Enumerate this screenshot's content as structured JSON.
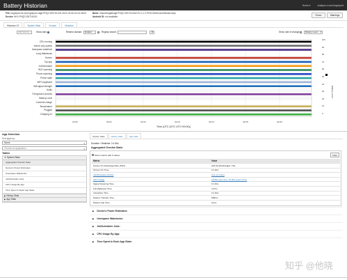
{
  "app": {
    "title": "Battery Historian"
  },
  "nav": {
    "links": [
      "Home ▾",
      "Analyze a new bugreport"
    ]
  },
  "info": {
    "file_label": "File:",
    "file_value": "bugreport-hk.zip bugreport-nagit-PHQ2.190716.001-2021-04-06-22-04-38.txt",
    "device_label": "Device:",
    "device_value": "MI 4 PHQ2.190716.001",
    "build_label": "Build:",
    "build_value": "Xiaomi/nagit/nagit PHQ2.190716.001/V11.2.1.0.PCKCNXM:user/release-keys",
    "android_label": "Android ID:",
    "android_value": "not available",
    "buttons": [
      "Errors",
      "Warnings"
    ]
  },
  "tabs": [
    "Historian V2",
    "System Stats",
    "Custom",
    "Historian"
  ],
  "toolbar": {
    "add_metrics": "Add Metrics",
    "show_bars": "Show bars",
    "restrict_domain": "Restrict domain:",
    "restrict_value": "Default",
    "regexp_search": "Regexp search",
    "show_rate": "Show rate of change",
    "battery_level": "Battery Level"
  },
  "timeline": {
    "rows": [
      {
        "label": "CPU running",
        "color": "#000000"
      },
      {
        "label": "Kernel only uptime",
        "color": "#6b6b6b"
      },
      {
        "label": "Userspace wakelock",
        "color": "#4b2c86"
      },
      {
        "label": "Long Wakelocks",
        "color": "#ffffff"
      },
      {
        "label": "Screen",
        "color": "#c0392b"
      },
      {
        "label": "Top app",
        "color": "#1a5fb4"
      },
      {
        "label": "JobScheduler",
        "color": "#f39c12"
      },
      {
        "label": "BLE scanning",
        "color": "#2e8b57"
      },
      {
        "label": "Phone scanning",
        "color": "#2a46c8"
      },
      {
        "label": "Phone state",
        "color": "#26a3a3"
      },
      {
        "label": "WiFi supplicant",
        "color": "#9fb7d8"
      },
      {
        "label": "Wifi signal strength",
        "color": "#1f6fb8"
      },
      {
        "label": "Audio",
        "color": "#ffffff"
      },
      {
        "label": "Foreground process",
        "color": "#7f3f98"
      },
      {
        "label": "Battery Level",
        "color": "#ffffff"
      },
      {
        "label": "Coulomb charge",
        "color": "#ffffff"
      },
      {
        "label": "Temperature",
        "color": "#c9b25a"
      },
      {
        "label": "Plugged",
        "color": "#4d4d4d"
      },
      {
        "label": "Charging on",
        "color": "#3cb043"
      }
    ],
    "x_ticks": [
      "02:20",
      "02:21",
      "02:22",
      "02:23",
      "02:24",
      "02:25",
      "02:26"
    ],
    "x_title": "Time (UTC (UTC UTC+00:00))",
    "legend_ticks": [
      "100",
      "90",
      "80",
      "70",
      "60",
      "50",
      "40",
      "30",
      "20",
      "10",
      "0"
    ],
    "legend_title": "Battery Level"
  },
  "left_panel": {
    "title": "App Selection",
    "sort_label": "Sort apps by:",
    "sort_value": "Name",
    "app_placeholder": "Choose an application",
    "tables_title": "Tables",
    "system_stats": "System Stats",
    "items": [
      "Aggregated Checkin Stats",
      "Device's Power Estimates",
      "Userspace Wakelocks",
      "JobScheduler Jobs",
      "CPU Usage By App",
      "Time Spent In Each App State"
    ],
    "history_stats": "History Stats",
    "app_stats": "App Stats"
  },
  "right_panel": {
    "tabs": [
      "System Stats",
      "History Stats",
      "App Stats"
    ],
    "duration": "Duration / Realtime: 1h 16m",
    "section_title": "Aggregated Checkin Stats:",
    "show_zero": "Show metrics with 0 values",
    "filter_btn": "Filter",
    "table_headers": [
      "Metric",
      "Value"
    ],
    "rows": [
      {
        "metric": "Screen On Discharge Rate (%/hr)",
        "value": "222.32 (Discharged: 7%)",
        "link": false
      },
      {
        "metric": "Screen On Time",
        "value": "1h 16m",
        "link": false
      },
      {
        "metric": "JobScheduler Activity",
        "value": "0ms (1 times)",
        "link": true
      },
      {
        "metric": "CPU Usage",
        "value": "26.68s user time, 23.99s system time",
        "link": true
      },
      {
        "metric": "Signal Scanning Time",
        "value": "1h 16m",
        "link": false
      },
      {
        "metric": "Full Wakelock Time",
        "value": "3.37m",
        "link": false
      },
      {
        "metric": "Interactive Time",
        "value": "1h 16m",
        "link": false
      },
      {
        "metric": "Modem Transfer Time",
        "value": "568ms",
        "link": false
      },
      {
        "metric": "Modem Idle Time",
        "value": "11ms",
        "link": false
      }
    ],
    "sections": [
      "Device's Power Estimates:",
      "Userspace Wakelocks:",
      "JobScheduler Jobs:",
      "CPU Usage By App:",
      "Time Spent In Each App State:"
    ]
  },
  "watermark": "知乎 @他晓"
}
